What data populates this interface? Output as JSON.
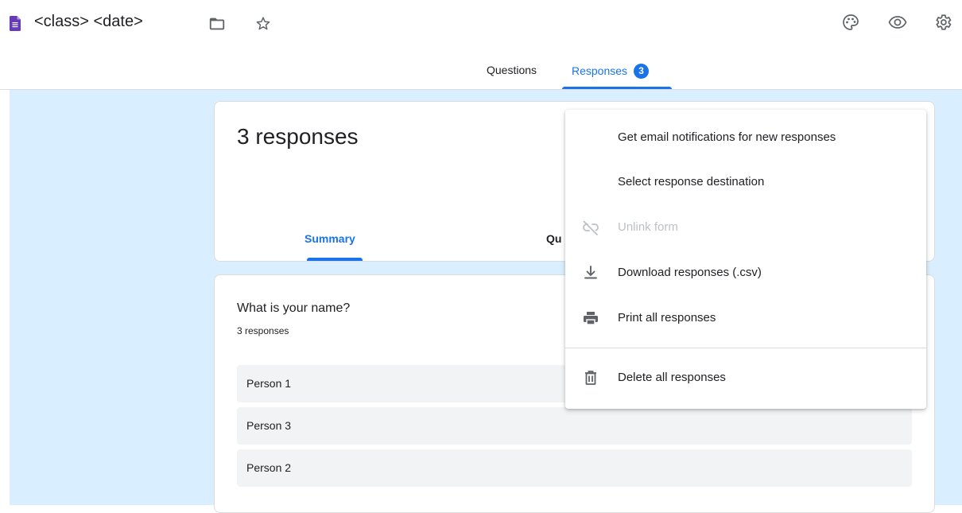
{
  "app": {
    "doc_title": "<class> <date>",
    "accent": "#1a73e8",
    "brand_color": "#673ab7"
  },
  "header_icons": {
    "left": [
      "folder-icon",
      "star-icon"
    ],
    "right": [
      "palette-icon",
      "eye-icon",
      "settings-icon"
    ]
  },
  "tabs": {
    "questions": "Questions",
    "responses": "Responses",
    "responses_count": "3"
  },
  "summary": {
    "count_title": "3 responses",
    "subtabs": {
      "summary": "Summary",
      "question_partial": "Qu"
    }
  },
  "question": {
    "title": "What is your name?",
    "responses_count": "3 responses",
    "answers": [
      "Person 1",
      "Person 3",
      "Person 2"
    ]
  },
  "menu": {
    "items": [
      {
        "label": "Get email notifications for new responses",
        "icon": "",
        "disabled": false
      },
      {
        "label": "Select response destination",
        "icon": "",
        "disabled": false
      },
      {
        "label": "Unlink form",
        "icon": "unlink-icon",
        "disabled": true
      },
      {
        "label": "Download responses (.csv)",
        "icon": "download-icon",
        "disabled": false
      },
      {
        "label": "Print all responses",
        "icon": "print-icon",
        "disabled": false
      },
      {
        "label": "Delete all responses",
        "icon": "trash-icon",
        "disabled": false
      }
    ]
  }
}
